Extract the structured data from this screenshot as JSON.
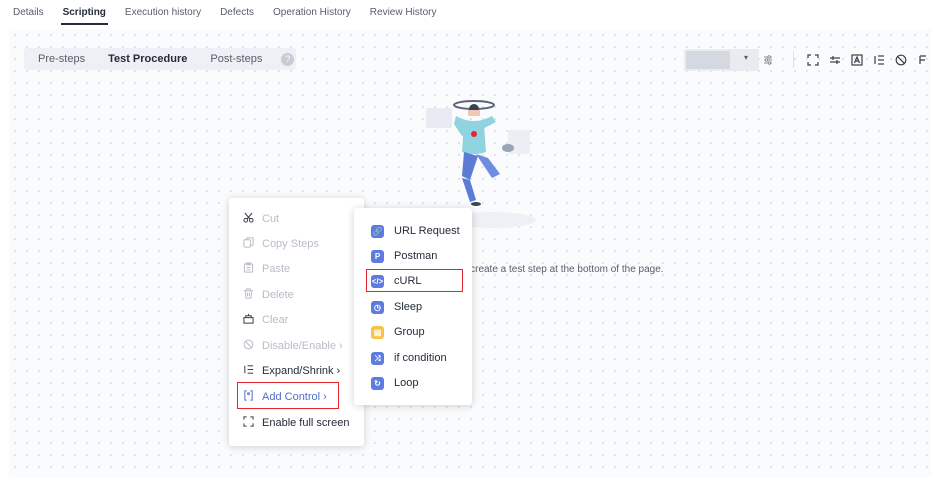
{
  "top_tabs": {
    "details": "Details",
    "scripting": "Scripting",
    "execution_history": "Execution history",
    "defects": "Defects",
    "operation_history": "Operation History",
    "review_history": "Review History"
  },
  "step_tabs": {
    "pre": "Pre-steps",
    "test": "Test Procedure",
    "post": "Post-steps",
    "help": "?"
  },
  "toolbar": {
    "caret": "▾",
    "settings_icon": "⚙",
    "fullscreen_icon": "⛶",
    "filter_icon": "≛",
    "text_icon": "A",
    "indent_icon": "⁝≡",
    "disable_icon": "⦸",
    "more_icon": "⭍"
  },
  "empty_hint": "r create a test step at the bottom of the page.",
  "context_menu": {
    "cut": "Cut",
    "copy_steps": "Copy Steps",
    "paste": "Paste",
    "delete": "Delete",
    "clear": "Clear",
    "disable_enable": "Disable/Enable",
    "expand_shrink": "Expand/Shrink",
    "add_control": "Add Control",
    "enable_full_screen": "Enable full screen",
    "arrow": "›"
  },
  "submenu": {
    "url_request": "URL Request",
    "postman": "Postman",
    "curl": "cURL",
    "sleep": "Sleep",
    "group": "Group",
    "if_condition": "if condition",
    "loop": "Loop"
  },
  "colors": {
    "accent": "#526ecc",
    "highlight_border": "#e5262c",
    "url_request_icon": "#5e7ce0",
    "postman_icon": "#5e7ce0",
    "curl_icon": "#5e7ce0",
    "sleep_icon": "#5e7ce0",
    "group_icon": "#f6c543",
    "if_condition_icon": "#5e7ce0",
    "loop_icon": "#5e7ce0"
  }
}
